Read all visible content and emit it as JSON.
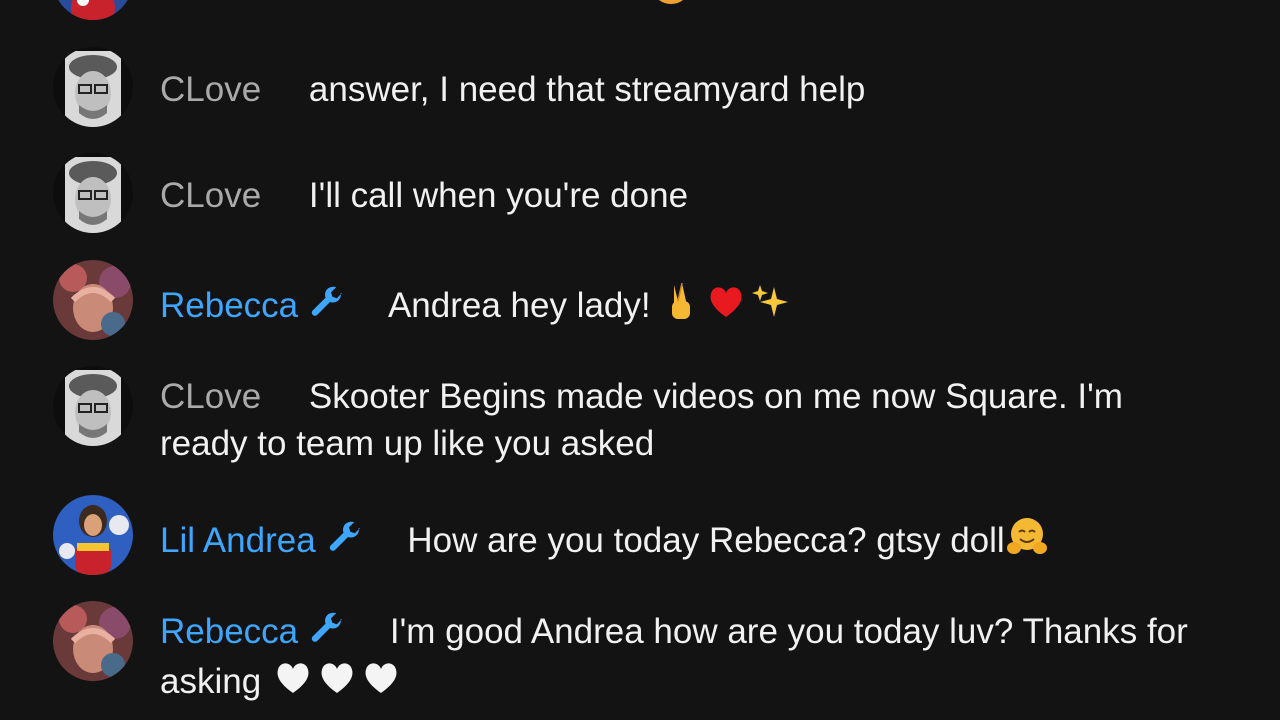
{
  "chat": {
    "messages": [
      {
        "author": "CLove",
        "role": "viewer",
        "text": "answer, I need that streamyard help",
        "emojis": []
      },
      {
        "author": "CLove",
        "role": "viewer",
        "text": "I'll call when you're done",
        "emojis": []
      },
      {
        "author": "Rebecca",
        "role": "moderator",
        "text": "Andrea hey lady!",
        "emojis": [
          "victory-hand-icon",
          "red-heart-icon",
          "sparkles-icon"
        ]
      },
      {
        "author": "CLove",
        "role": "viewer",
        "text": "Skooter Begins made videos on me now Square. I'm ready to team up like you asked",
        "emojis": []
      },
      {
        "author": "Lil Andrea",
        "role": "moderator",
        "text": "How are you today Rebecca? gtsy doll",
        "emojis": [
          "hugging-face-icon"
        ]
      },
      {
        "author": "Rebecca",
        "role": "moderator",
        "text": "I'm good Andrea how are you today luv? Thanks for asking",
        "emojis": [
          "white-heart-icon",
          "white-heart-icon",
          "white-heart-icon"
        ]
      }
    ]
  },
  "colors": {
    "background": "#131313",
    "viewer_name": "#aaaaaa",
    "moderator_name": "#3ea6ff",
    "message_text": "#f1f1f1"
  }
}
